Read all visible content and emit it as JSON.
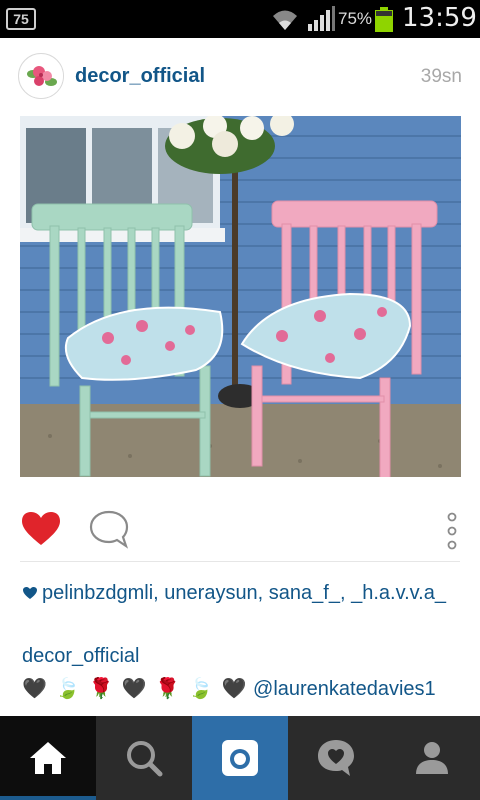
{
  "status_bar": {
    "notification": "75",
    "battery_percent": "75%",
    "time": "13:59",
    "icons": [
      "wifi-icon",
      "signal-icon",
      "battery-icon"
    ]
  },
  "post": {
    "username": "decor_official",
    "time_ago": "39sn",
    "liked": true,
    "likes_text": "pelinbzdgmli, uneraysun, sana_f_, _h.a.v.v.a_",
    "caption_user": "decor_official",
    "caption_glyphs": "🖤 🍃 🌹 🖤 🌹 🍃 🖤",
    "caption_mention": "@laurenkatedavies1"
  },
  "bottom_nav": {
    "items": [
      "home",
      "search",
      "camera",
      "activity",
      "profile"
    ],
    "active": "home"
  },
  "colors": {
    "link_blue": "#125688",
    "like_red": "#e0242b",
    "nav_bg": "#2b2b2b",
    "camera_blue": "#2e6ea8"
  }
}
